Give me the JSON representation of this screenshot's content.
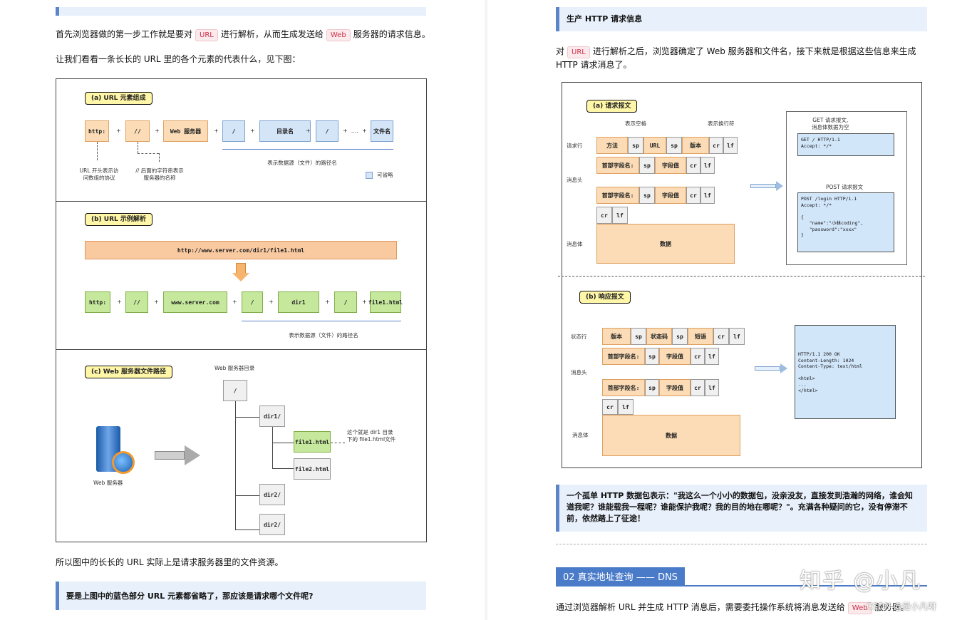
{
  "left": {
    "intro_pre": "首先浏览器做的第一步工作就是要对",
    "intro_tag1": "URL",
    "intro_mid": "进行解析，从而生成发送给",
    "intro_tag2": "Web",
    "intro_post": "服务器的请求信息。",
    "see_text": "让我们看看一条长长的 URL 里的各个元素的代表什么，见下图：",
    "figA": {
      "label": "(a)  URL 元素组成",
      "boxes": [
        "http:",
        "//",
        "Web 服务器",
        "/",
        "目录名",
        "/",
        "文件名"
      ],
      "plus": "+",
      "dots": "+  ....  +",
      "note_http": "URL 开头表示访\n问数组的协议",
      "note_slash": "// 后面的字符串表示\n服务器的名称",
      "note_path": "表示数据源（文件）的路径名",
      "legend": "可省略"
    },
    "figB": {
      "label": "(b)  URL 示例解析",
      "url": "http://www.server.com/dir1/file1.html",
      "boxes": [
        "http:",
        "//",
        "www.server.com",
        "/",
        "dir1",
        "/",
        "file1.html"
      ],
      "note_path": "表示数据源（文件）的路径名"
    },
    "figC": {
      "label": "(c)  Web 服务器文件路径",
      "tree_title": "Web 服务器目录",
      "nodes": [
        "/",
        "dir1/",
        "file1.html",
        "file2.html",
        "dir2/",
        "dir2/"
      ],
      "note": "这个就是 dir1 目录\n下的 file1.html文件",
      "server_label": "Web 服务器"
    },
    "conclusion": "所以图中的长长的 URL 实际上是请求服务器里的文件资源。",
    "question": "要是上图中的蓝色部分 URL 元素都省略了，那应该是请求哪个文件呢?"
  },
  "right": {
    "callout_title": "生产 HTTP 请求信息",
    "para_pre": "对",
    "para_tag": "URL",
    "para_post": "进行解析之后，浏览器确定了 Web 服务器和文件名，接下来就是根据这些信息来生成 HTTP 请求消息了。",
    "req": {
      "label": "(a) 请求报文",
      "space_note": "表示空格",
      "newline_note": "表示换行符",
      "row_labels": [
        "请求行",
        "消息头",
        "消息体"
      ],
      "line_boxes": [
        "方法",
        "sp",
        "URL",
        "sp",
        "版本",
        "cr",
        "lf"
      ],
      "header_boxes": [
        "首部字段名:",
        "sp",
        "字段值",
        "cr",
        "lf"
      ],
      "crlf": [
        "cr",
        "lf"
      ],
      "body": "数据",
      "get_title": "GET 请求报文,\n消息体数据为空",
      "get_code": "GET / HTTP/1.1\nAccept: */*",
      "post_title": "POST 请求报文",
      "post_code": "POST /login HTTP/1.1\nAccept: */*\n\n{\n   \"name\":\"小林coding\",\n   \"password\":\"xxxx\"\n}"
    },
    "resp": {
      "label": "(b) 响应报文",
      "row_labels": [
        "状态行",
        "消息头",
        "消息体"
      ],
      "line_boxes": [
        "版本",
        "sp",
        "状态码",
        "sp",
        "短语",
        "cr",
        "lf"
      ],
      "header_boxes": [
        "首部字段名:",
        "sp",
        "字段值",
        "cr",
        "lf"
      ],
      "crlf": [
        "cr",
        "lf"
      ],
      "body": "数据",
      "code": "HTTP/1.1 200 OK\nContent-Length: 1024\nContent-Type: text/html\n\n<html>\n...\n</html>"
    },
    "quote": "一个孤单 HTTP 数据包表示：\"我这么一个小小的数据包，没亲没友，直接发到浩瀚的网络，谁会知道我呢？谁能载我一程呢？谁能保护我呢？我的目的地在哪呢？\"。充满各种疑问的它，没有停滞不前，依然踏上了征途！",
    "section_heading": "02 真实地址查询 —— DNS",
    "bottom_pre": "通过浏览器解析 URL 并生成 HTTP 消息后，需要委托操作系统将消息发送给",
    "bottom_tag": "Web",
    "bottom_post": "服务器。",
    "watermark": "知乎 @小凡",
    "watermark_small": "CSDN @是小凡呀"
  },
  "colors": {
    "accent": "#4a7bc8",
    "orange": "#fbdcb6",
    "blue": "#d4e5f8",
    "green": "#c5e89c",
    "callout": "#e8f0fb"
  }
}
